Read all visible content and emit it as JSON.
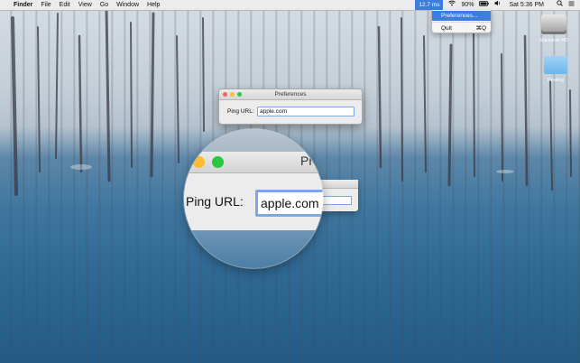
{
  "menubar": {
    "apple": "",
    "app": "Finder",
    "menus": [
      "File",
      "Edit",
      "View",
      "Go",
      "Window",
      "Help"
    ],
    "ping_status": "12.7 ms",
    "wifi_icon": "wifi-icon",
    "battery": "90%",
    "volume_icon": "volume-icon",
    "clock": "Sat 5:36 PM",
    "search_icon": "search-icon",
    "list_icon": "notification-list-icon"
  },
  "dropdown": {
    "items": [
      {
        "label": "Preferences...",
        "selected": true
      },
      {
        "label": "Quit",
        "shortcut": "⌘Q"
      }
    ]
  },
  "desktop": {
    "icons": [
      {
        "label": "Macintosh HD"
      },
      {
        "label": "Desktop"
      }
    ]
  },
  "prefs_window": {
    "title": "Preferences",
    "ping_label": "Ping URL:",
    "ping_value": "apple.com"
  },
  "magnifier": {
    "title_fragment": "Pr",
    "ping_label": "Ping URL:",
    "ping_value": "apple.com"
  },
  "colors": {
    "accent": "#3d7ddb",
    "focus_ring": "#7aa8e8",
    "close": "#fc5f57",
    "minimize": "#fdbc2e",
    "zoom": "#28c840"
  }
}
